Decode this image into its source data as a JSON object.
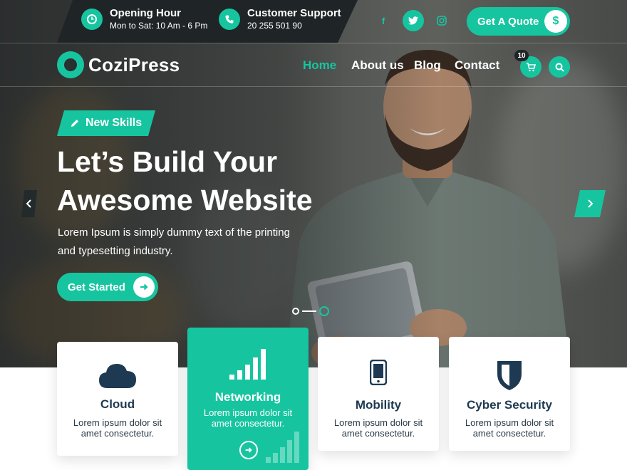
{
  "topbar": {
    "opening_title": "Opening Hour",
    "opening_value": "Mon to Sat: 10 Am - 6 Pm",
    "support_title": "Customer Support",
    "support_value": "20 255 501 90",
    "social": [
      {
        "icon": "facebook-icon",
        "glyph": "f"
      },
      {
        "icon": "twitter-icon",
        "glyph": "t"
      },
      {
        "icon": "instagram-icon",
        "glyph": "i"
      }
    ],
    "quote_label": "Get A Quote",
    "quote_icon": "$"
  },
  "nav": {
    "logo_text": "CoziPress",
    "items": [
      "Home",
      "About us",
      "Blog",
      "Contact"
    ],
    "active_item": "Home",
    "cart_count": "10"
  },
  "hero": {
    "badge": "New Skills",
    "headline_line1": "Let’s Build Your",
    "headline_line2": "Awesome Website",
    "subtext": "Lorem Ipsum is simply dummy text of the printing and typesetting industry.",
    "cta_label": "Get Started"
  },
  "cards": [
    {
      "title": "Cloud",
      "desc": "Lorem ipsum dolor sit amet consectetur.",
      "icon": "cloud-icon"
    },
    {
      "title": "Networking",
      "desc": "Lorem ipsum dolor sit amet consectetur.",
      "icon": "signal-bars-icon"
    },
    {
      "title": "Mobility",
      "desc": "Lorem ipsum dolor sit amet consectetur.",
      "icon": "smartphone-icon"
    },
    {
      "title": "Cyber Security",
      "desc": "Lorem ipsum dolor sit amet consectetur.",
      "icon": "shield-icon"
    }
  ],
  "colors": {
    "accent": "#16c5a0",
    "dark": "#1f2526",
    "heading": "#1d3a52"
  }
}
